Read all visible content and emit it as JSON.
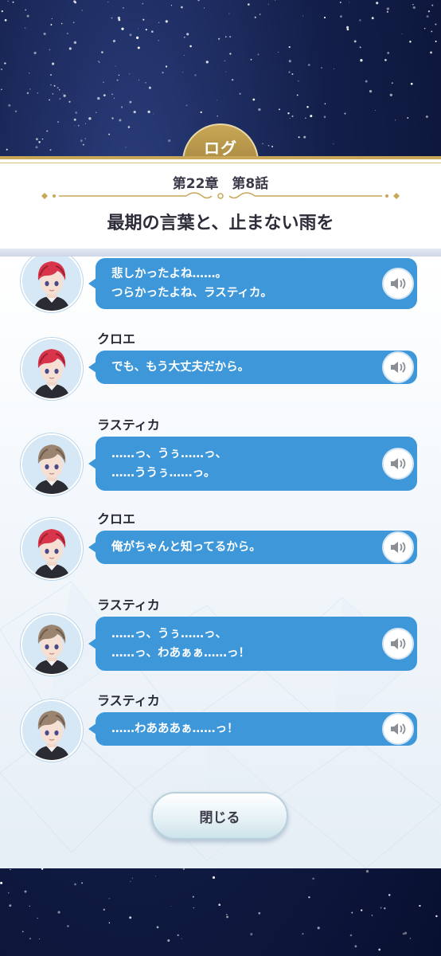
{
  "header": {
    "tab_label": "ログ",
    "chapter": "第22章　第8話",
    "title": "最期の言葉と、止まない雨を"
  },
  "log_entries": [
    {
      "speaker": "",
      "lines": [
        "悲しかったよね……。",
        "つらかったよね、ラスティカ。"
      ],
      "avatar": "red-hair-character"
    },
    {
      "speaker": "クロエ",
      "lines": [
        "でも、もう大丈夫だから。"
      ],
      "avatar": "red-hair-character"
    },
    {
      "speaker": "ラスティカ",
      "lines": [
        "……っ、うぅ……っ、",
        "……ううぅ……っ。"
      ],
      "avatar": "brown-hair-character"
    },
    {
      "speaker": "クロエ",
      "lines": [
        "俺がちゃんと知ってるから。"
      ],
      "avatar": "red-hair-character"
    },
    {
      "speaker": "ラスティカ",
      "lines": [
        "……っ、うぅ……っ、",
        "……っ、わあぁぁ……っ！"
      ],
      "avatar": "brown-hair-character"
    },
    {
      "speaker": "ラスティカ",
      "lines": [
        "……わあああぁ……っ！"
      ],
      "avatar": "brown-hair-character"
    }
  ],
  "close_button": {
    "label": "閉じる"
  },
  "icons": {
    "voice": "speaker-icon"
  },
  "colors": {
    "bubble": "#3d97d9",
    "gold": "#c9a758",
    "sky": "#131f4a"
  }
}
